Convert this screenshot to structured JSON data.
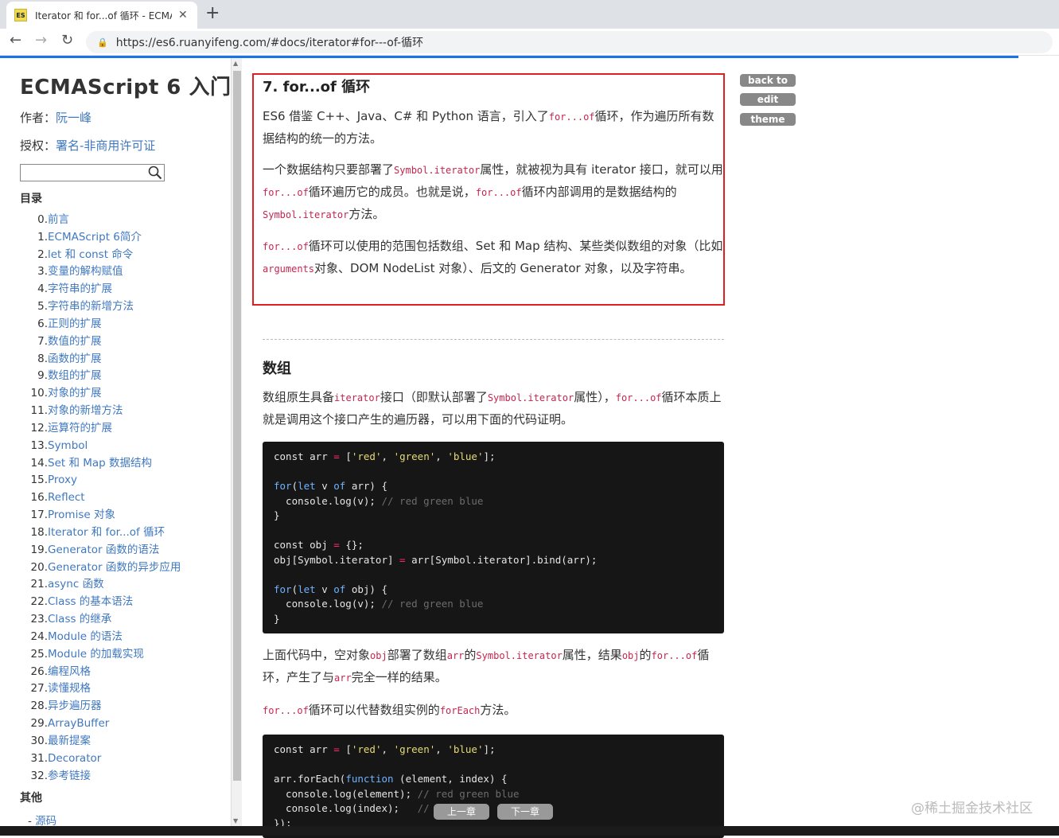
{
  "browser": {
    "tab_title": "Iterator 和 for...of 循环 - ECMA",
    "tab_favicon": "ES",
    "url": "https://es6.ruanyifeng.com/#docs/iterator#for---of-循环"
  },
  "sidebar": {
    "title": "ECMAScript 6 入门",
    "author_label": "作者：",
    "author": "阮一峰",
    "license_label": "授权：",
    "license": "署名-非商用许可证",
    "toc_heading": "目录",
    "toc": [
      {
        "num": "0.",
        "label": "前言"
      },
      {
        "num": "1.",
        "label": "ECMAScript 6简介"
      },
      {
        "num": "2.",
        "label": "let 和 const 命令"
      },
      {
        "num": "3.",
        "label": "变量的解构赋值"
      },
      {
        "num": "4.",
        "label": "字符串的扩展"
      },
      {
        "num": "5.",
        "label": "字符串的新增方法"
      },
      {
        "num": "6.",
        "label": "正则的扩展"
      },
      {
        "num": "7.",
        "label": "数值的扩展"
      },
      {
        "num": "8.",
        "label": "函数的扩展"
      },
      {
        "num": "9.",
        "label": "数组的扩展"
      },
      {
        "num": "10.",
        "label": "对象的扩展"
      },
      {
        "num": "11.",
        "label": "对象的新增方法"
      },
      {
        "num": "12.",
        "label": "运算符的扩展"
      },
      {
        "num": "13.",
        "label": "Symbol"
      },
      {
        "num": "14.",
        "label": "Set 和 Map 数据结构"
      },
      {
        "num": "15.",
        "label": "Proxy"
      },
      {
        "num": "16.",
        "label": "Reflect"
      },
      {
        "num": "17.",
        "label": "Promise 对象"
      },
      {
        "num": "18.",
        "label": "Iterator 和 for...of 循环"
      },
      {
        "num": "19.",
        "label": "Generator 函数的语法"
      },
      {
        "num": "20.",
        "label": "Generator 函数的异步应用"
      },
      {
        "num": "21.",
        "label": "async 函数"
      },
      {
        "num": "22.",
        "label": "Class 的基本语法"
      },
      {
        "num": "23.",
        "label": "Class 的继承"
      },
      {
        "num": "24.",
        "label": "Module 的语法"
      },
      {
        "num": "25.",
        "label": "Module 的加载实现"
      },
      {
        "num": "26.",
        "label": "编程风格"
      },
      {
        "num": "27.",
        "label": "读懂规格"
      },
      {
        "num": "28.",
        "label": "异步遍历器"
      },
      {
        "num": "29.",
        "label": "ArrayBuffer"
      },
      {
        "num": "30.",
        "label": "最新提案"
      },
      {
        "num": "31.",
        "label": "Decorator"
      },
      {
        "num": "32.",
        "label": "参考链接"
      }
    ],
    "other_heading": "其他",
    "source_prefix": "- ",
    "source_label": "源码"
  },
  "content": {
    "section_title": "7. for...of 循环",
    "p1": {
      "a": "ES6 借鉴 C++、Java、C# 和 Python 语言，引入了",
      "code1": "for...of",
      "b": "循环，作为遍历所有数据结构的统一的方法。"
    },
    "p2": {
      "a": "一个数据结构只要部署了",
      "code1": "Symbol.iterator",
      "b": "属性，就被视为具有 iterator 接口，就可以用",
      "code2": "for...of",
      "c": "循环遍历它的成员。也就是说，",
      "code3": "for...of",
      "d": "循环内部调用的是数据结构的",
      "code4": "Symbol.iterator",
      "e": "方法。"
    },
    "p3": {
      "code1": "for...of",
      "a": "循环可以使用的范围包括数组、Set 和 Map 结构、某些类似数组的对象（比如",
      "code2": "arguments",
      "b": "对象、DOM NodeList 对象）、后文的 Generator 对象，以及字符串。"
    },
    "sub_title": "数组",
    "p4": {
      "a": "数组原生具备",
      "code1": "iterator",
      "b": "接口（即默认部署了",
      "code2": "Symbol.iterator",
      "c": "属性），",
      "code3": "for...of",
      "d": "循环本质上就是调用这个接口产生的遍历器，可以用下面的代码证明。"
    },
    "p5": {
      "a": "上面代码中，空对象",
      "code1": "obj",
      "b": "部署了数组",
      "code2": "arr",
      "c": "的",
      "code3": "Symbol.iterator",
      "d": "属性，结果",
      "code4": "obj",
      "e": "的",
      "code5": "for...of",
      "f": "循环，产生了与",
      "code6": "arr",
      "g": "完全一样的结果。"
    },
    "p6": {
      "code1": "for...of",
      "a": "循环可以代替数组实例的",
      "code2": "forEach",
      "b": "方法。"
    }
  },
  "tools": {
    "back_to_top": "back to top",
    "edit": "edit",
    "theme": "theme"
  },
  "pager": {
    "prev": "上一章",
    "next": "下一章"
  },
  "watermark": "@稀土掘金技术社区"
}
